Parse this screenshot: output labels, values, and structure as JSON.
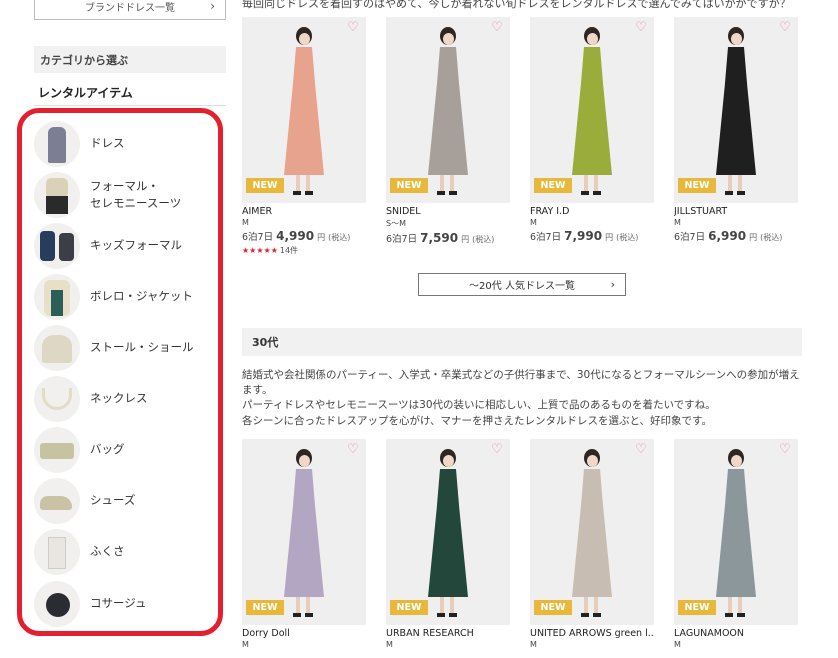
{
  "sidebar": {
    "brand_list_button": "ブランドドレス一覧",
    "category_heading": "カテゴリから選ぶ",
    "rental_heading": "レンタルアイテム",
    "items": [
      {
        "label": "ドレス"
      },
      {
        "label": "フォーマル・\nセレモニースーツ"
      },
      {
        "label": "キッズフォーマル"
      },
      {
        "label": "ボレロ・ジャケット"
      },
      {
        "label": "ストール・ショール"
      },
      {
        "label": "ネックレス"
      },
      {
        "label": "バッグ"
      },
      {
        "label": "シューズ"
      },
      {
        "label": "ふくさ"
      },
      {
        "label": "コサージュ"
      }
    ],
    "highlight_color": "#e4202e"
  },
  "intro_top": "毎回同じドレスを着回すのはやめて、今しか着れない旬ドレスをレンタルドレスで選んでみてはいかがですか？",
  "row1": [
    {
      "brand": "AIMER",
      "size": "M",
      "plan": "6泊7日",
      "price": "4,990",
      "unit": "円",
      "tax": "(税込)",
      "new": "NEW",
      "stars": "★★★★★",
      "reviews": "14件"
    },
    {
      "brand": "SNIDEL",
      "size": "S～M",
      "plan": "6泊7日",
      "price": "7,590",
      "unit": "円",
      "tax": "(税込)",
      "new": "NEW"
    },
    {
      "brand": "FRAY I.D",
      "size": "M",
      "plan": "6泊7日",
      "price": "7,990",
      "unit": "円",
      "tax": "(税込)",
      "new": "NEW"
    },
    {
      "brand": "JILLSTUART",
      "size": "M",
      "plan": "6泊7日",
      "price": "6,990",
      "unit": "円",
      "tax": "(税込)",
      "new": "NEW"
    }
  ],
  "more_button": "～20代 人気ドレス一覧",
  "section30": {
    "title": "30代",
    "lines": [
      "結婚式や会社関係のパーティー、入学式・卒業式などの子供行事まで、30代になるとフォーマルシーンへの参加が増えます。",
      "パーティドレスやセレモニースーツは30代の装いに相応しい、上質で品のあるものを着たいですね。",
      "各シーンに合ったドレスアップを心がけ、マナーを押さえたレンタルドレスを選ぶと、好印象です。"
    ]
  },
  "row2": [
    {
      "brand": "Dorry Doll",
      "size": "M",
      "new": "NEW"
    },
    {
      "brand": "URBAN RESEARCH",
      "size": "M",
      "new": "NEW"
    },
    {
      "brand": "UNITED ARROWS green l...",
      "size": "M",
      "new": "NEW"
    },
    {
      "brand": "LAGUNAMOON",
      "size": "M",
      "new": "NEW"
    }
  ],
  "colors": {
    "row1": [
      "#e8a38f",
      "#a79f99",
      "#9aac3a",
      "#1f1f1f"
    ],
    "row2": [
      "#b3a6c3",
      "#24473b",
      "#c8bdb3",
      "#8c979c"
    ],
    "new_tag": "#e7b83b"
  },
  "icons": {
    "heart": "heart-outline-icon",
    "chevron": "chevron-right-icon"
  }
}
